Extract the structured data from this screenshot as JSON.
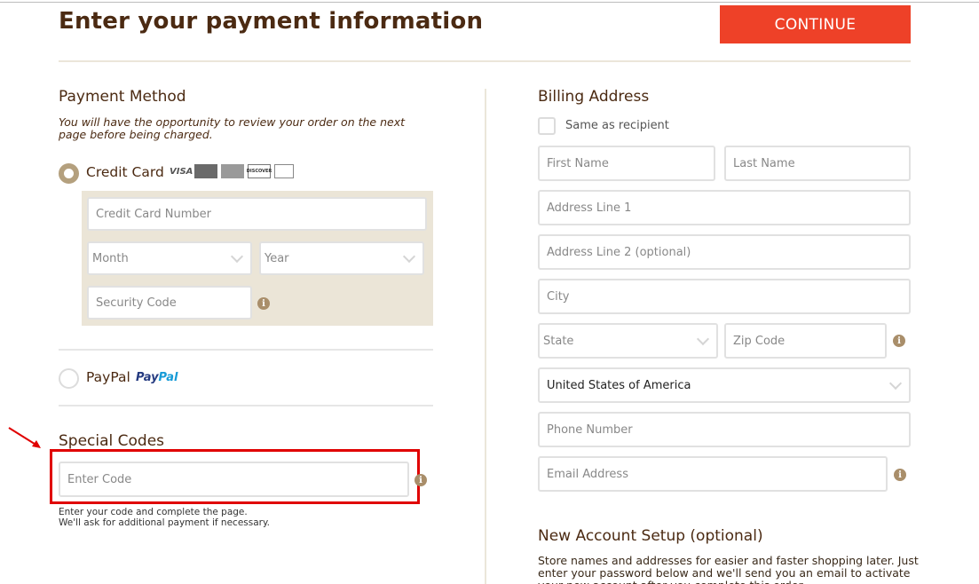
{
  "header": {
    "title": "Enter your payment information",
    "continue_label": "CONTINUE",
    "accent_color": "#ee4128"
  },
  "payment_method": {
    "heading": "Payment Method",
    "note": "You will have the opportunity to review your order on the next page before being charged.",
    "credit_card": {
      "label": "Credit Card",
      "selected": true,
      "logos": [
        "VISA",
        "MasterCard",
        "American Express",
        "DISCOVER",
        "Diners Club"
      ],
      "fields": {
        "number_placeholder": "Credit Card Number",
        "month_value": "Month",
        "year_value": "Year",
        "security_placeholder": "Security Code"
      }
    },
    "paypal": {
      "label": "PayPal",
      "selected": false,
      "logo_part1": "Pay",
      "logo_part2": "Pal"
    }
  },
  "special_codes": {
    "heading": "Special Codes",
    "placeholder": "Enter Code",
    "help_line1": "Enter your code and complete the page.",
    "help_line2": "We'll ask for additional payment if necessary."
  },
  "billing": {
    "heading": "Billing Address",
    "same_as_recipient_label": "Same as recipient",
    "same_as_recipient_checked": false,
    "first_name_placeholder": "First Name",
    "last_name_placeholder": "Last Name",
    "address1_placeholder": "Address Line 1",
    "address2_placeholder": "Address Line 2 (optional)",
    "city_placeholder": "City",
    "state_value": "State",
    "zip_placeholder": "Zip Code",
    "country_value": "United States of America",
    "phone_placeholder": "Phone Number",
    "email_placeholder": "Email Address"
  },
  "account": {
    "heading": "New Account Setup (optional)",
    "text": "Store names and addresses for easier and faster shopping later. Just enter your password below and we'll send you an email to activate your new account after you complete this order."
  },
  "icons": {
    "info": "i"
  }
}
